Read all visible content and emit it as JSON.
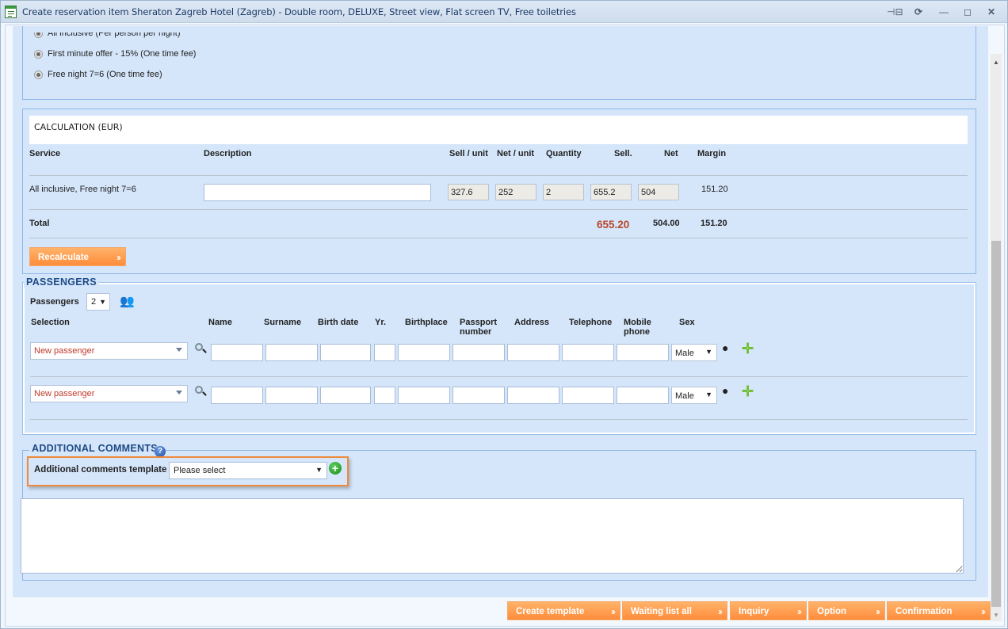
{
  "window": {
    "title": "Create reservation item Sheraton Zagreb Hotel (Zagreb) - Double room, DELUXE, Street view, Flat screen TV, Free toiletries",
    "controls": {
      "pin": "⊣⊟",
      "refresh": "⟳",
      "minimize": "—",
      "maximize": "◻",
      "close": "✕"
    }
  },
  "supplements": {
    "options": [
      {
        "label": "All inclusive (Per person per night)"
      },
      {
        "label": "First minute offer - 15% (One time fee)"
      },
      {
        "label": "Free night 7=6 (One time fee)"
      }
    ]
  },
  "calculation": {
    "title": "CALCULATION (EUR)",
    "columns": {
      "service": "Service",
      "description": "Description",
      "sell_unit": "Sell / unit",
      "net_unit": "Net / unit",
      "quantity": "Quantity",
      "sell": "Sell.",
      "net": "Net",
      "margin": "Margin"
    },
    "rows": [
      {
        "service": "All inclusive, Free night 7=6",
        "description": "",
        "sell_unit": "327.6",
        "net_unit": "252",
        "quantity": "2",
        "sell": "655.2",
        "net": "504",
        "margin": "151.20"
      }
    ],
    "total": {
      "label": "Total",
      "sell": "655.20",
      "net": "504.00",
      "margin": "151.20"
    },
    "recalculate_label": "Recalculate",
    "total_color": "#b9472a"
  },
  "passengers": {
    "legend": "PASSENGERS",
    "count_label": "Passengers",
    "count_value": "2",
    "columns": {
      "selection": "Selection",
      "name": "Name",
      "surname": "Surname",
      "birth_date": "Birth date",
      "yr": "Yr.",
      "birthplace": "Birthplace",
      "passport": "Passport number",
      "address": "Address",
      "telephone": "Telephone",
      "mobile": "Mobile phone",
      "sex": "Sex"
    },
    "rows": [
      {
        "selection": "New passenger",
        "sex": "Male"
      },
      {
        "selection": "New passenger",
        "sex": "Male"
      }
    ]
  },
  "comments": {
    "legend": "ADDITIONAL COMMENTS",
    "template_label": "Additional comments template",
    "template_value": "Please select",
    "text": ""
  },
  "footer": {
    "buttons": [
      {
        "label": "Create template"
      },
      {
        "label": "Waiting list all"
      },
      {
        "label": "Inquiry"
      },
      {
        "label": "Option"
      },
      {
        "label": "Confirmation"
      }
    ]
  },
  "colors": {
    "accent_orange": "#ff8c3b",
    "panel_bg": "#d5e6fb",
    "legend_blue": "#1e4a86",
    "passenger_select_text": "#c0392b"
  }
}
